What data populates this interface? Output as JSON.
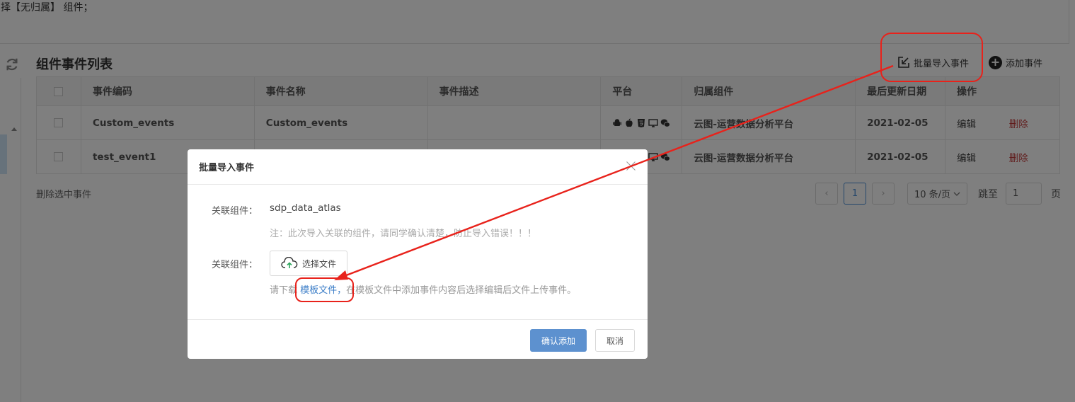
{
  "top_notice": {
    "text": "择【无归属】 组件；"
  },
  "list": {
    "title": "组件事件列表",
    "batch_import_label": "批量导入事件",
    "add_event_label": "添加事件",
    "columns": [
      "事件编码",
      "事件名称",
      "事件描述",
      "平台",
      "归属组件",
      "最后更新日期",
      "操作"
    ],
    "rows": [
      {
        "code": "Custom_events",
        "name": "Custom_events",
        "desc": "",
        "component": "云图-运营数据分析平台",
        "updated": "2021-02-05",
        "edit": "编辑",
        "delete": "删除"
      },
      {
        "code": "test_event1",
        "name": "",
        "desc": "",
        "component": "云图-运营数据分析平台",
        "updated": "2021-02-05",
        "edit": "编辑",
        "delete": "删除"
      }
    ],
    "platform_icons": [
      "android-icon",
      "apple-icon",
      "html5-icon",
      "desktop-icon",
      "wechat-icon"
    ],
    "delete_selected_label": "删除选中事件"
  },
  "pagination": {
    "prev": "‹",
    "current": "1",
    "next": "›",
    "page_size": "10 条/页",
    "jump_label": "跳至",
    "jump_value": "1",
    "page_suffix": "页"
  },
  "modal": {
    "title": "批量导入事件",
    "field1_label": "关联组件：",
    "field1_value": "sdp_data_atlas",
    "note": "注：此次导入关联的组件，请同学确认清楚，防止导入错误！！！",
    "field2_label": "关联组件：",
    "upload_label": "选择文件",
    "hint_prefix": "请下载",
    "hint_link": "模板文件，",
    "hint_suffix": "在模板文件中添加事件内容后选择编辑后文件上传事件。",
    "confirm_label": "确认添加",
    "cancel_label": "取消"
  },
  "colors": {
    "accent": "#4a8ed6",
    "annotation_red": "#e8221b",
    "primary_button": "#5d91cf"
  }
}
